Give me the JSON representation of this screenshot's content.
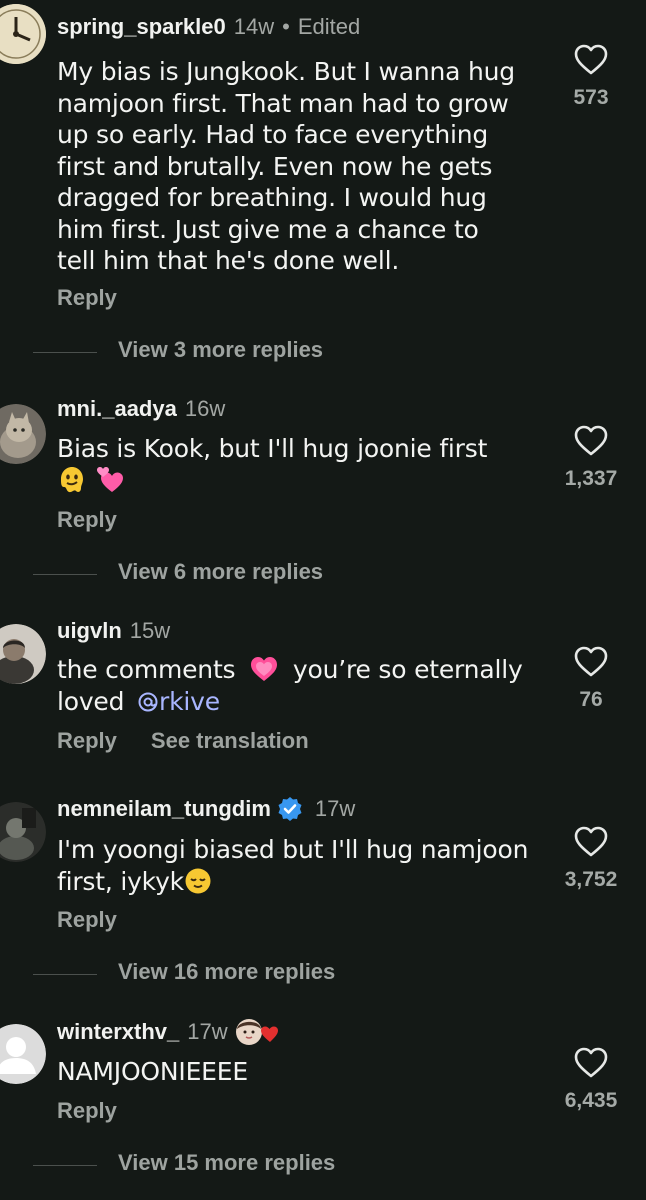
{
  "comments": [
    {
      "username": "spring_sparkle0",
      "age": "14w",
      "separator": "•",
      "edited": "Edited",
      "lines": [
        "My bias is Jungkook. But I wanna hug",
        "namjoon first. That man had to grow",
        "up so early. Had to face everything",
        "first and brutally. Even now he gets",
        "dragged for breathing. I would hug",
        "him first. Just give me a chance to",
        "tell him that he's done well."
      ],
      "reply": "Reply",
      "likes": "573",
      "more_replies": "View 3 more replies"
    },
    {
      "username": "mni._aadya",
      "age": "16w",
      "line1": "Bias is Kook, but I'll hug joonie first",
      "reply": "Reply",
      "likes": "1,337",
      "more_replies": "View 6 more replies"
    },
    {
      "username": "uigvln",
      "age": "15w",
      "line1_a": "the comments",
      "line1_b": "you’re so eternally",
      "line2_a": "loved",
      "mention": "rkive",
      "reply": "Reply",
      "see_translation": "See translation",
      "likes": "76"
    },
    {
      "username": "nemneilam_tungdim",
      "age": "17w",
      "line1": "I'm yoongi biased but I'll hug namjoon",
      "line2": "first, iykyk",
      "reply": "Reply",
      "likes": "3,752",
      "more_replies": "View 16 more replies"
    },
    {
      "username": "winterxthv_",
      "age": "17w",
      "line1": "NAMJOONIEEEE",
      "reply": "Reply",
      "likes": "6,435",
      "more_replies": "View 15 more replies"
    }
  ],
  "icons": {
    "like": "heart-outline-icon",
    "verified": "verified-badge-icon",
    "mention_prefix": "at-sign-icon"
  },
  "colors": {
    "background": "#141916",
    "text": "#f3f4f2",
    "muted": "#9ea3a0",
    "mention": "#a9b6ff",
    "verified": "#3897f0"
  }
}
